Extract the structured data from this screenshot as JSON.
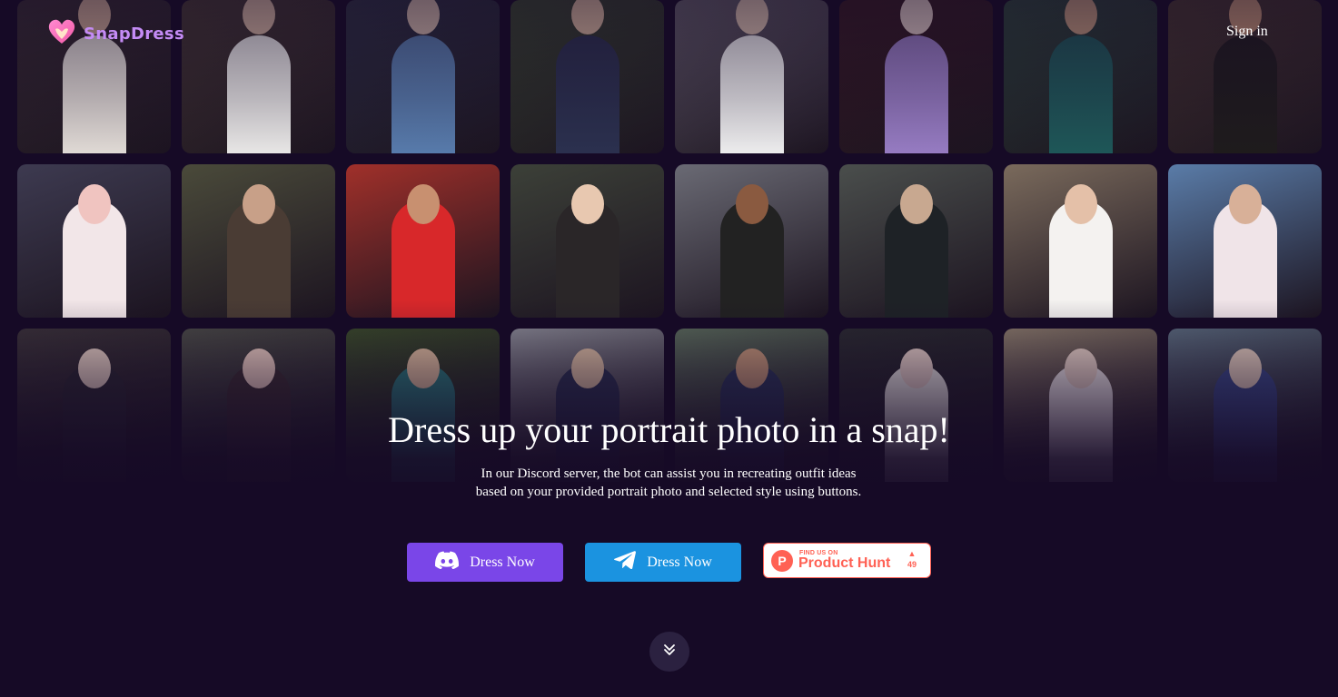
{
  "brand": {
    "name": "SnapDress",
    "logo_icon": "heart-logo-icon",
    "accent": "#c48bf5"
  },
  "header": {
    "signin_label": "Sign in"
  },
  "hero": {
    "title": "Dress up your portrait photo in a snap!",
    "subtitle_line1": "In our Discord server, the bot can assist you in recreating outfit ideas",
    "subtitle_line2": "based on your provided portrait photo and selected style using buttons."
  },
  "buttons": {
    "discord": {
      "label": "Dress Now",
      "icon": "discord-icon",
      "color": "#7a46e8"
    },
    "telegram": {
      "label": "Dress Now",
      "icon": "telegram-icon",
      "color": "#1b93e0"
    },
    "producthunt": {
      "small": "FIND US ON",
      "big": "Product Hunt",
      "letter": "P",
      "votes": "49",
      "color": "#ff6154"
    }
  },
  "scroll": {
    "icon": "chevrons-down-icon"
  },
  "gallery": {
    "rows": [
      [
        {
          "bg": "#3a2f33",
          "outfit": "#e8e2dc",
          "skin": "#d9b49c"
        },
        {
          "bg": "#4a3d35",
          "outfit": "#f0efed",
          "skin": "#e0bfa8"
        },
        {
          "bg": "#2f3446",
          "outfit": "#5a7fb0",
          "skin": "#dcc2b2"
        },
        {
          "bg": "#3b4a30",
          "outfit": "#2c3250",
          "skin": "#e2c0a4"
        },
        {
          "bg": "#6b6670",
          "outfit": "#f5f5f5",
          "skin": "#e6cbb7"
        },
        {
          "bg": "#3a1c22",
          "outfit": "#9b80c8",
          "skin": "#e8d2cc"
        },
        {
          "bg": "#2f4a3c",
          "outfit": "#1f5a5a",
          "skin": "#c9a080"
        },
        {
          "bg": "#4b3a30",
          "outfit": "#1f1c1c",
          "skin": "#c99877"
        }
      ],
      [
        {
          "bg": "#3d3a50",
          "outfit": "#f2e6e8",
          "skin": "#f0c4c0"
        },
        {
          "bg": "#4a4a3a",
          "outfit": "#4a3c34",
          "skin": "#c8a088"
        },
        {
          "bg": "#a0302a",
          "outfit": "#d8282a",
          "skin": "#c89070"
        },
        {
          "bg": "#3c4038",
          "outfit": "#2a2628",
          "skin": "#e8c8b0"
        },
        {
          "bg": "#6a6a74",
          "outfit": "#222222",
          "skin": "#8a5a40"
        },
        {
          "bg": "#4a4e4c",
          "outfit": "#1e2226",
          "skin": "#c8a890"
        },
        {
          "bg": "#7a6a5c",
          "outfit": "#f4f2f0",
          "skin": "#e4c0a8"
        },
        {
          "bg": "#5a7ca8",
          "outfit": "#f0e4e8",
          "skin": "#d8b098"
        }
      ],
      [
        {
          "bg": "#3a3238",
          "outfit": "#2a2630",
          "skin": "#e8d0c4"
        },
        {
          "bg": "#4a4a46",
          "outfit": "#3a2c30",
          "skin": "#f0d0c4"
        },
        {
          "bg": "#3a4a2a",
          "outfit": "#2a7a7a",
          "skin": "#e4c0a0"
        },
        {
          "bg": "#8a8a94",
          "outfit": "#2a3050",
          "skin": "#e0c0a4"
        },
        {
          "bg": "#5a6a5a",
          "outfit": "#2a3458",
          "skin": "#c89878"
        },
        {
          "bg": "#2a2a30",
          "outfit": "#e8e4e0",
          "skin": "#e8d0c8"
        },
        {
          "bg": "#8a7a6a",
          "outfit": "#f4ecec",
          "skin": "#f0d8cc"
        },
        {
          "bg": "#5a6a7c",
          "outfit": "#3a4a8a",
          "skin": "#e8d0c0"
        }
      ]
    ]
  }
}
